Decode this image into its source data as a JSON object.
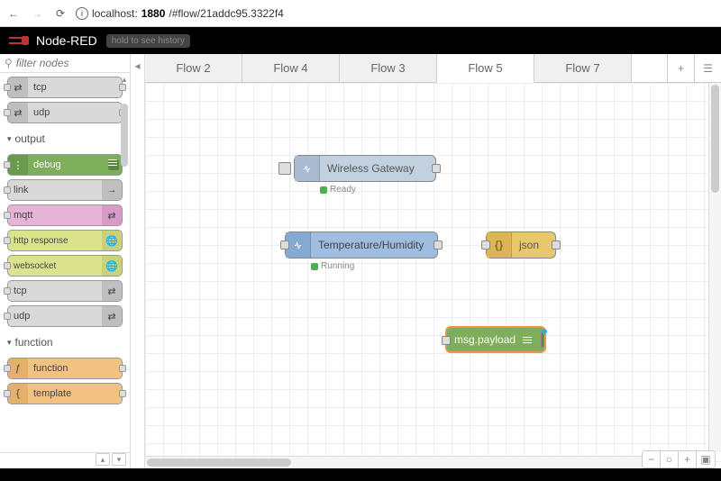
{
  "browser": {
    "url_host": "localhost:",
    "url_port": "1880",
    "url_path": "/#flow/21addc95.3322f4"
  },
  "header": {
    "app_name": "Node-RED",
    "history_hint": "hold to see history"
  },
  "palette": {
    "search_placeholder": "filter nodes",
    "sections": {
      "output": "output",
      "function": "function"
    },
    "nodes": {
      "tcp_in": "tcp",
      "udp_in": "udp",
      "debug": "debug",
      "link": "link",
      "mqtt": "mqtt",
      "http_response": "http response",
      "websocket": "websocket",
      "tcp_out": "tcp",
      "udp_out": "udp",
      "function": "function",
      "template": "template"
    }
  },
  "tabs": {
    "t1": "Flow 2",
    "t2": "Flow 4",
    "t3": "Flow 3",
    "t4": "Flow 5",
    "t5": "Flow 7"
  },
  "flow_nodes": {
    "gateway": {
      "label": "Wireless Gateway",
      "status": "Ready"
    },
    "temphum": {
      "label": "Temperature/Humidity",
      "status": "Running"
    },
    "json": {
      "label": "json"
    },
    "debug": {
      "label": "msg.payload"
    }
  },
  "status_colors": {
    "ready": "#4caf50",
    "running": "#4caf50"
  }
}
